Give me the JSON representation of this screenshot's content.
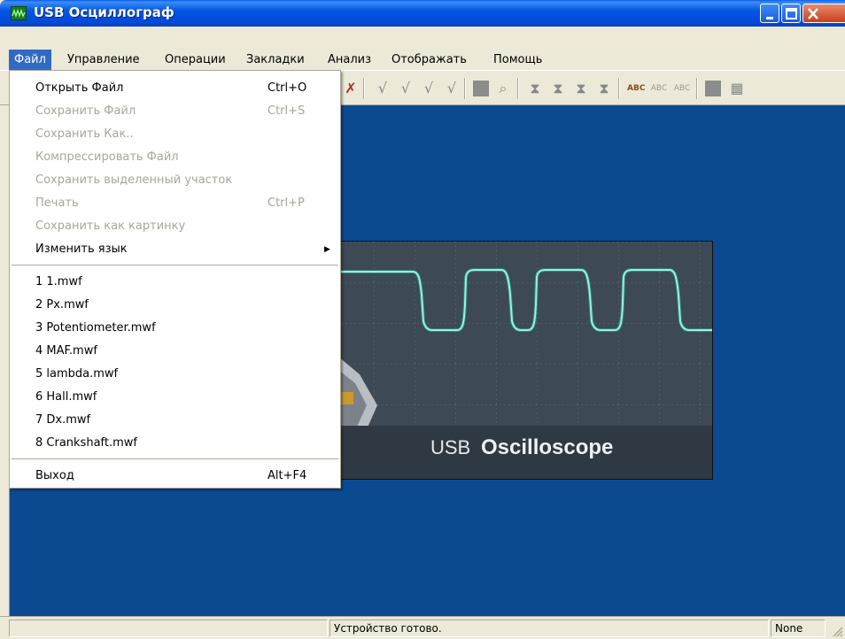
{
  "window": {
    "title": "USB Осциллограф"
  },
  "menubar": {
    "items": [
      {
        "label": "Файл"
      },
      {
        "label": "Управление"
      },
      {
        "label": "Операции"
      },
      {
        "label": "Закладки"
      },
      {
        "label": "Анализ"
      },
      {
        "label": "Отображать"
      },
      {
        "label": "Помощь"
      }
    ]
  },
  "file_menu": {
    "items": [
      {
        "label": "Открыть Файл",
        "shortcut": "Ctrl+O",
        "enabled": true
      },
      {
        "label": "Сохранить Файл",
        "shortcut": "Ctrl+S",
        "enabled": false
      },
      {
        "label": "Сохранить Как..",
        "shortcut": "",
        "enabled": false
      },
      {
        "label": "Компрессировать Файл",
        "shortcut": "",
        "enabled": false
      },
      {
        "label": "Сохранить выделенный участок",
        "shortcut": "",
        "enabled": false
      },
      {
        "label": "Печать",
        "shortcut": "Ctrl+P",
        "enabled": false
      },
      {
        "label": "Сохранить как картинку",
        "shortcut": "",
        "enabled": false
      },
      {
        "label": "Изменить язык",
        "shortcut": "",
        "enabled": true,
        "submenu": true
      }
    ],
    "recent": [
      {
        "label": "1 1.mwf"
      },
      {
        "label": "2 Px.mwf"
      },
      {
        "label": "3 Potentiometer.mwf"
      },
      {
        "label": "4 MAF.mwf"
      },
      {
        "label": "5 lambda.mwf"
      },
      {
        "label": "6 Hall.mwf"
      },
      {
        "label": "7 Dx.mwf"
      },
      {
        "label": "8 Crankshaft.mwf"
      }
    ],
    "exit": {
      "label": "Выход",
      "shortcut": "Alt+F4"
    }
  },
  "splash": {
    "brand_prefix": "USB",
    "brand_name": "Oscilloscope"
  },
  "statusbar": {
    "panel1": "",
    "panel2": "Устройство готово.",
    "panel3": "None"
  },
  "colors": {
    "client_bg": "#0b4a91",
    "menu_highlight": "#316ac5",
    "trace": "#3fe0c0"
  }
}
